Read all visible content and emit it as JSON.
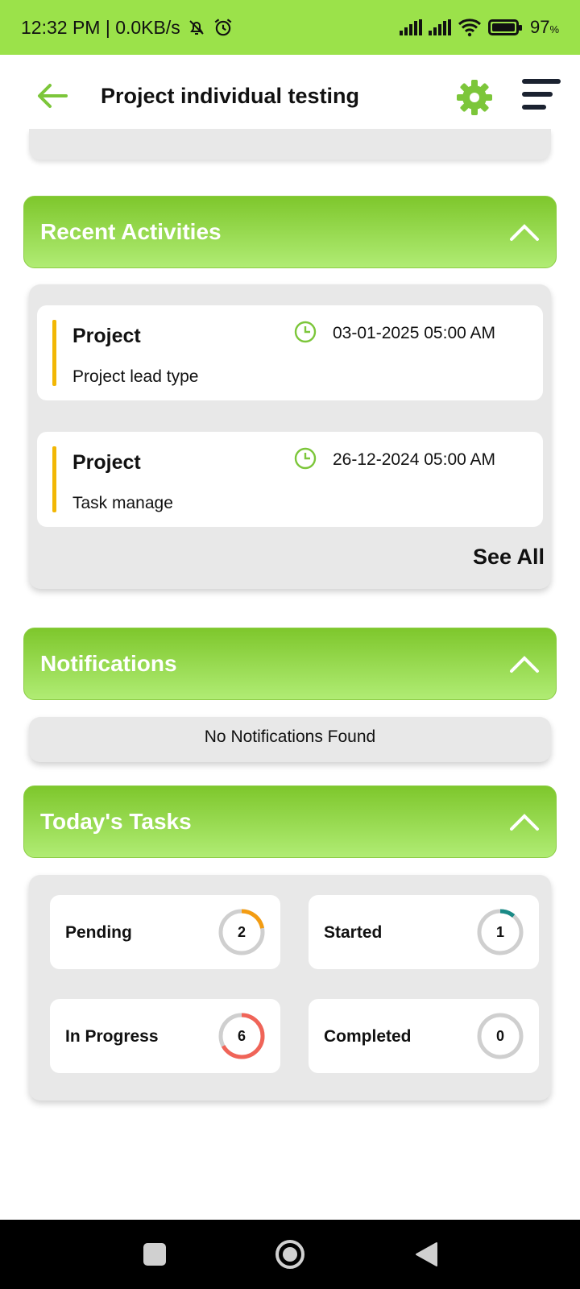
{
  "status_bar": {
    "time": "12:32 PM | 0.0KB/s",
    "battery": "97"
  },
  "app_bar": {
    "title": "Project individual testing"
  },
  "recent_activities": {
    "title": "Recent Activities",
    "items": [
      {
        "title": "Project",
        "description": "Project lead type",
        "date": "03-01-2025 05:00 AM"
      },
      {
        "title": "Project",
        "description": "Task manage",
        "date": "26-12-2024 05:00 AM"
      }
    ],
    "see_all": "See All"
  },
  "notifications": {
    "title": "Notifications",
    "empty_text": "No Notifications Found"
  },
  "todays_tasks": {
    "title": "Today's Tasks",
    "cards": [
      {
        "label": "Pending",
        "count": "2",
        "fraction": 0.22,
        "color": "#f39c12"
      },
      {
        "label": "Started",
        "count": "1",
        "fraction": 0.11,
        "color": "#1a8a86"
      },
      {
        "label": "In Progress",
        "count": "6",
        "fraction": 0.67,
        "color": "#f06458"
      },
      {
        "label": "Completed",
        "count": "0",
        "fraction": 0,
        "color": "#bdbdbd"
      }
    ]
  },
  "colors": {
    "status_bar": "#9be24a",
    "header_green": "#7ec72c",
    "accent_yellow": "#f2b705"
  }
}
